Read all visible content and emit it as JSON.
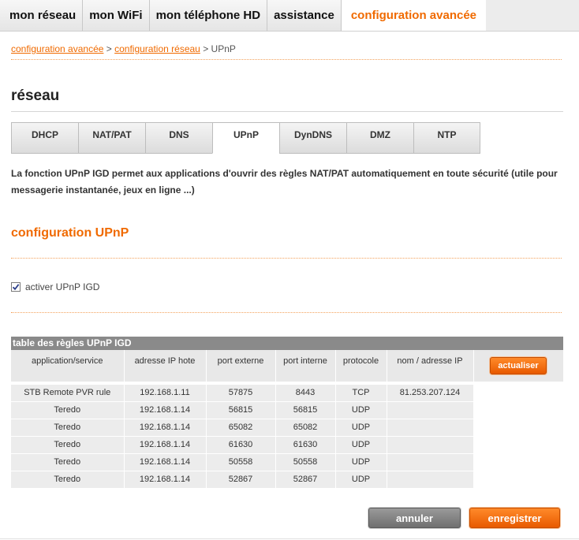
{
  "topnav": {
    "tabs": [
      {
        "label": "mon réseau"
      },
      {
        "label": "mon WiFi"
      },
      {
        "label": "mon téléphone HD"
      },
      {
        "label": "assistance"
      },
      {
        "label": "configuration avancée"
      }
    ],
    "active_index": 4
  },
  "breadcrumb": {
    "link1": "configuration avancée",
    "sep1": " > ",
    "link2": "configuration réseau",
    "sep2": " > ",
    "current": "UPnP"
  },
  "section": {
    "title": "réseau"
  },
  "subtabs": {
    "items": [
      "DHCP",
      "NAT/PAT",
      "DNS",
      "UPnP",
      "DynDNS",
      "DMZ",
      "NTP"
    ],
    "active": "UPnP"
  },
  "description": "La fonction UPnP IGD permet aux applications d'ouvrir des règles NAT/PAT automatiquement en toute sécurité (utile pour messagerie instantanée, jeux en ligne ...)",
  "config": {
    "title": "configuration UPnP",
    "checkbox_label": "activer UPnP IGD",
    "checkbox_checked": true
  },
  "table": {
    "caption": "table des règles UPnP IGD",
    "headers": [
      "application/service",
      "adresse IP hote",
      "port externe",
      "port interne",
      "protocole",
      "nom / adresse IP"
    ],
    "refresh_label": "actualiser",
    "rows": [
      [
        "STB Remote PVR rule",
        "192.168.1.11",
        "57875",
        "8443",
        "TCP",
        "81.253.207.124"
      ],
      [
        "Teredo",
        "192.168.1.14",
        "56815",
        "56815",
        "UDP",
        ""
      ],
      [
        "Teredo",
        "192.168.1.14",
        "65082",
        "65082",
        "UDP",
        ""
      ],
      [
        "Teredo",
        "192.168.1.14",
        "61630",
        "61630",
        "UDP",
        ""
      ],
      [
        "Teredo",
        "192.168.1.14",
        "50558",
        "50558",
        "UDP",
        ""
      ],
      [
        "Teredo",
        "192.168.1.14",
        "52867",
        "52867",
        "UDP",
        ""
      ]
    ]
  },
  "actions": {
    "cancel": "annuler",
    "save": "enregistrer"
  },
  "colors": {
    "accent": "#f06a00",
    "caption_bg": "#8a8a8a",
    "cell_bg": "#ececec"
  },
  "icons": {
    "checkbox": "checkmark-icon"
  }
}
